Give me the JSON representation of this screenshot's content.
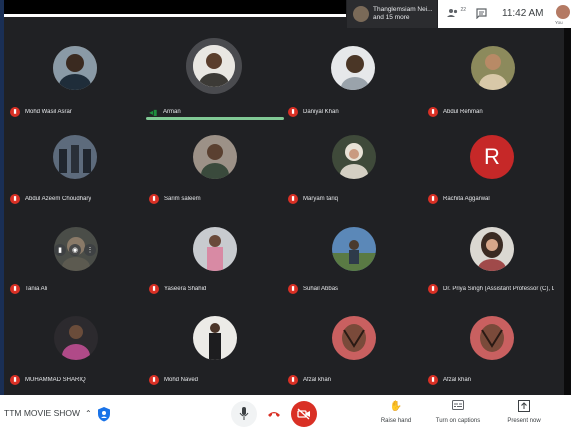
{
  "header": {
    "participants_pill": {
      "line1": "Thanglemsiam Nei...",
      "line2": "and 15 more"
    },
    "icons": [
      "people-icon",
      "chat-icon"
    ],
    "people_badge": "22",
    "time": "11:42 AM",
    "self_label": "You"
  },
  "tiles": [
    {
      "name": "Mohd Wasil Asrar",
      "muted": true
    },
    {
      "name": "Arman",
      "muted": false,
      "speaking": true
    },
    {
      "name": "Daniyal Khan",
      "muted": true
    },
    {
      "name": "Abdul Rehman",
      "muted": true
    },
    {
      "name": "Abdul Azeem Choudhary",
      "muted": true
    },
    {
      "name": "Sarim saleem",
      "muted": true
    },
    {
      "name": "Maryam tariq",
      "muted": true
    },
    {
      "name": "Rachita Aggarwal",
      "muted": true,
      "initial": "R"
    },
    {
      "name": "Tania Ali",
      "muted": true
    },
    {
      "name": "Yaseera Shahid",
      "muted": true
    },
    {
      "name": "Suhail Abbas",
      "muted": true
    },
    {
      "name": "Dr. Priya Singh (Assistant Professor (C), D/o ...",
      "muted": true
    },
    {
      "name": "MUHAMMAD SHARIQ",
      "muted": true
    },
    {
      "name": "Mohd Naved",
      "muted": true
    },
    {
      "name": "Afzal khan",
      "muted": true
    },
    {
      "name": "Afzal khan",
      "muted": true
    }
  ],
  "footer": {
    "meeting_name": "TTM MOVIE SHOW",
    "controls": [
      "mic-icon",
      "end-call-icon",
      "camera-off-icon"
    ],
    "raise_hand": "Raise hand",
    "captions": "Turn on captions",
    "present": "Present now"
  },
  "colors": {
    "stage": "#202124",
    "muted": "#d93025",
    "speaking": "#81c995"
  }
}
